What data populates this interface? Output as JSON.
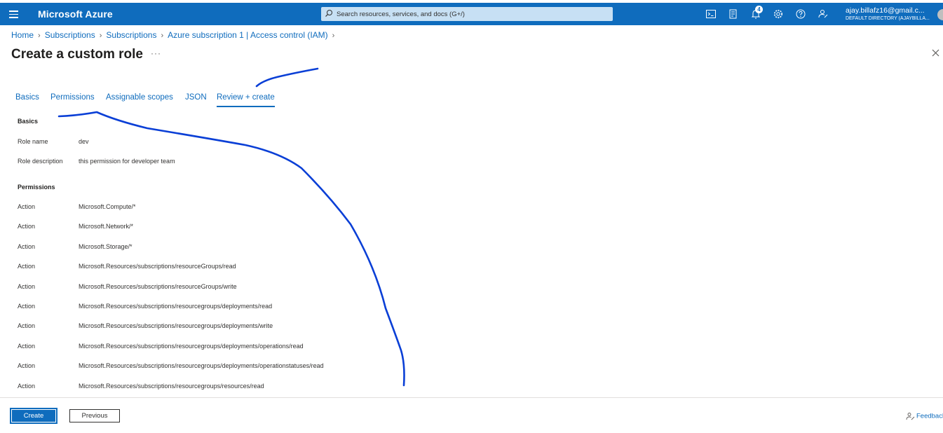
{
  "header": {
    "brand": "Microsoft Azure",
    "search_placeholder": "Search resources, services, and docs (G+/)",
    "notification_count": "4",
    "account_email": "ajay.billafz16@gmail.c...",
    "account_directory": "DEFAULT DIRECTORY (AJAYBILLA..."
  },
  "breadcrumb": {
    "items": [
      "Home",
      "Subscriptions",
      "Subscriptions",
      "Azure subscription 1 | Access control (IAM)"
    ]
  },
  "page": {
    "title": "Create a custom role",
    "more_label": "···"
  },
  "tabs": [
    "Basics",
    "Permissions",
    "Assignable scopes",
    "JSON",
    "Review + create"
  ],
  "active_tab": "Review + create",
  "review": {
    "basics_heading": "Basics",
    "role_name_label": "Role name",
    "role_name_value": "dev",
    "role_description_label": "Role description",
    "role_description_value": "this permission for developer team",
    "permissions_heading": "Permissions",
    "permissions": [
      {
        "type": "Action",
        "value": "Microsoft.Compute/*"
      },
      {
        "type": "Action",
        "value": "Microsoft.Network/*"
      },
      {
        "type": "Action",
        "value": "Microsoft.Storage/*"
      },
      {
        "type": "Action",
        "value": "Microsoft.Resources/subscriptions/resourceGroups/read"
      },
      {
        "type": "Action",
        "value": "Microsoft.Resources/subscriptions/resourceGroups/write"
      },
      {
        "type": "Action",
        "value": "Microsoft.Resources/subscriptions/resourcegroups/deployments/read"
      },
      {
        "type": "Action",
        "value": "Microsoft.Resources/subscriptions/resourcegroups/deployments/write"
      },
      {
        "type": "Action",
        "value": "Microsoft.Resources/subscriptions/resourcegroups/deployments/operations/read"
      },
      {
        "type": "Action",
        "value": "Microsoft.Resources/subscriptions/resourcegroups/deployments/operationstatuses/read"
      },
      {
        "type": "Action",
        "value": "Microsoft.Resources/subscriptions/resourcegroups/resources/read"
      }
    ]
  },
  "footer": {
    "create_label": "Create",
    "previous_label": "Previous",
    "feedback_label": "Feedback"
  },
  "colors": {
    "accent": "#0f6cbd",
    "annotation_ink": "#0a3fd6"
  }
}
